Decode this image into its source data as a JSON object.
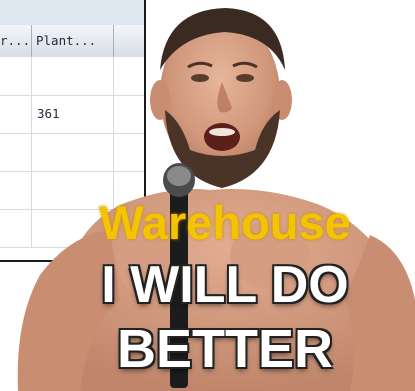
{
  "sap_grid": {
    "columns": [
      "r...",
      "Plant..."
    ],
    "rows": [
      {
        "col_a": "",
        "plant": ""
      },
      {
        "col_a": "",
        "plant": "361"
      },
      {
        "col_a": "",
        "plant": ""
      },
      {
        "col_a": "",
        "plant": ""
      },
      {
        "col_a": "",
        "plant": ""
      }
    ]
  },
  "meme": {
    "caption_top": "Warehouse",
    "caption_line1": "I WILL DO",
    "caption_line2": "BETTER",
    "colors": {
      "caption_top": "#f5c400",
      "caption_main": "#ffffff"
    }
  }
}
